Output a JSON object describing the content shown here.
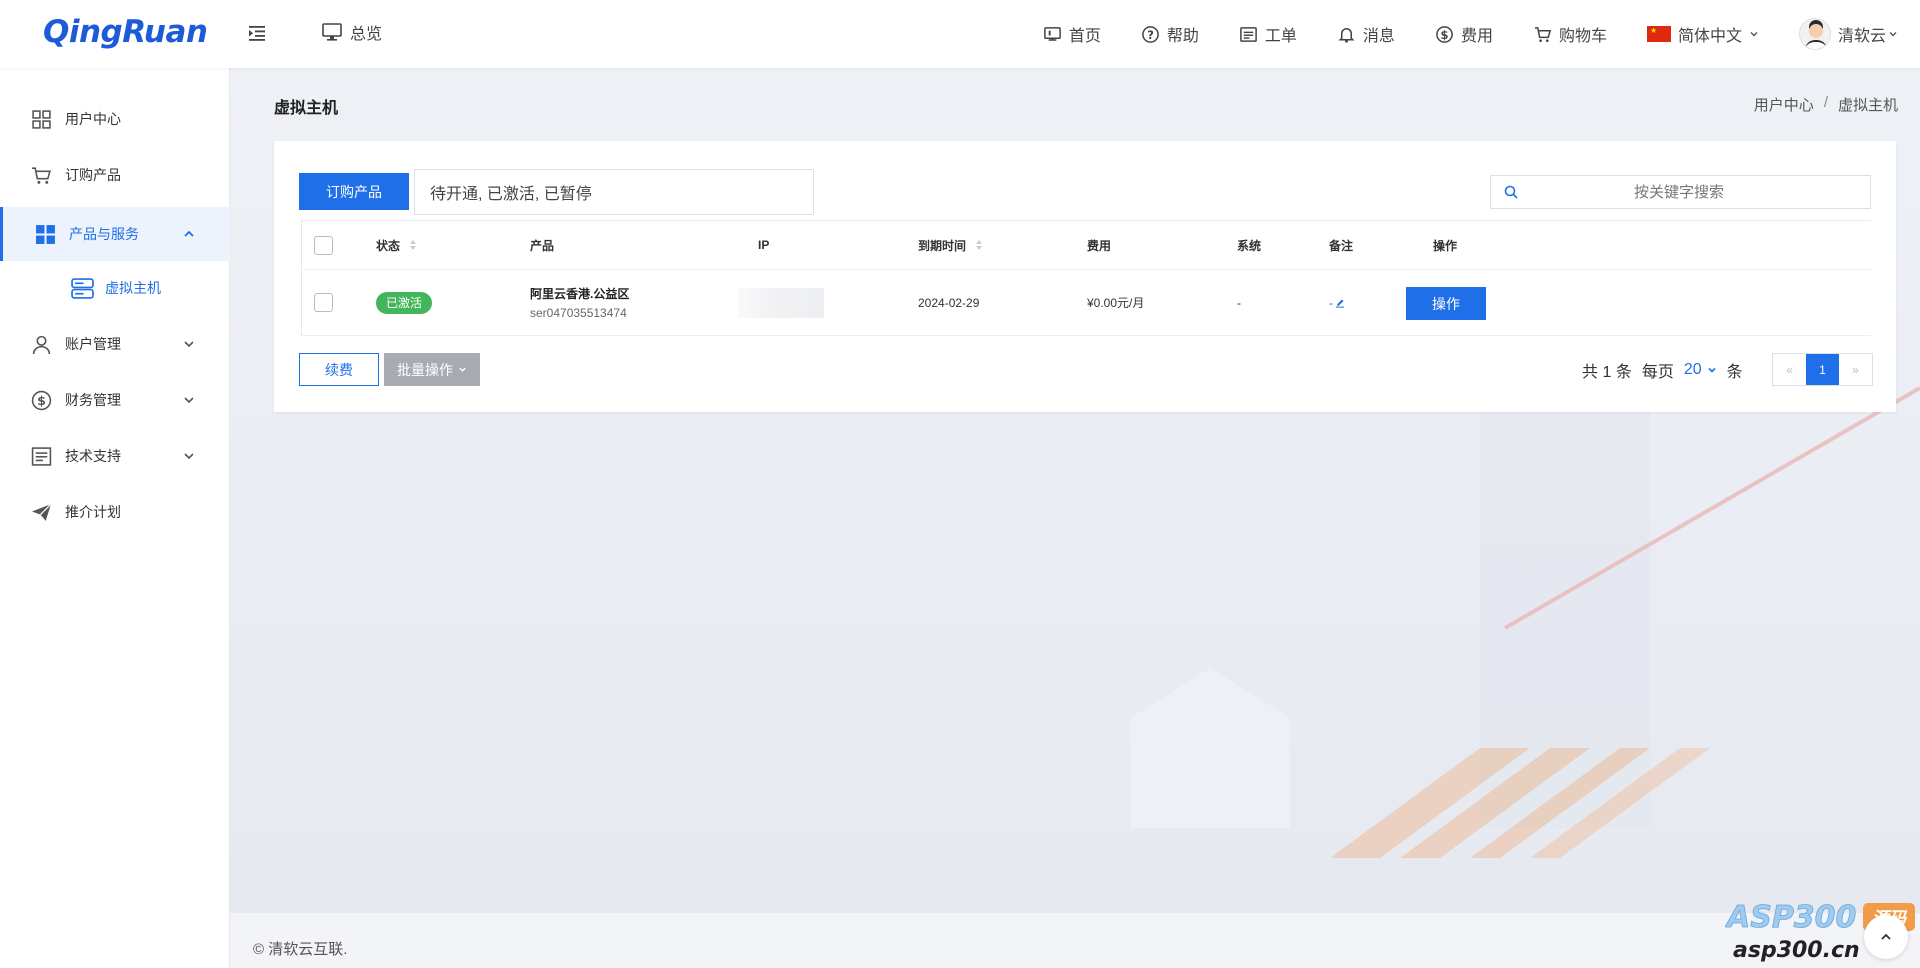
{
  "brand": {
    "logo": "QingRuan"
  },
  "header": {
    "overview_label": "总览",
    "nav": [
      {
        "label": "首页",
        "icon": "monitor-home-icon"
      },
      {
        "label": "帮助",
        "icon": "help-circle-icon"
      },
      {
        "label": "工单",
        "icon": "ticket-icon"
      },
      {
        "label": "消息",
        "icon": "bell-icon"
      },
      {
        "label": "费用",
        "icon": "dollar-circle-icon"
      },
      {
        "label": "购物车",
        "icon": "cart-icon"
      }
    ],
    "language": "简体中文",
    "user": "清软云"
  },
  "sidebar": {
    "items": [
      {
        "label": "用户中心",
        "icon": "grid-icon"
      },
      {
        "label": "订购产品",
        "icon": "cart-icon"
      },
      {
        "label": "产品与服务",
        "icon": "apps-icon",
        "active": true,
        "expanded": true
      },
      {
        "label": "虚拟主机",
        "icon": "server-icon",
        "sub": true
      },
      {
        "label": "账户管理",
        "icon": "user-icon"
      },
      {
        "label": "财务管理",
        "icon": "dollar-circle-icon"
      },
      {
        "label": "技术支持",
        "icon": "document-icon"
      },
      {
        "label": "推介计划",
        "icon": "send-icon"
      }
    ]
  },
  "page": {
    "title": "虚拟主机",
    "breadcrumb": [
      "用户中心",
      "虚拟主机"
    ]
  },
  "toolbar": {
    "order_button": "订购产品",
    "status_filter": "待开通, 已激活, 已暂停",
    "search_placeholder": "按关键字搜索"
  },
  "table": {
    "columns": [
      "状态",
      "产品",
      "IP",
      "到期时间",
      "费用",
      "系统",
      "备注",
      "操作"
    ],
    "rows": [
      {
        "status": "已激活",
        "product_name": "阿里云香港.公益区",
        "product_id": "ser047035513474",
        "ip": "",
        "expire": "2024-02-29",
        "fee": "¥0.00元/月",
        "os": "-",
        "note": "-",
        "action": "操作"
      }
    ]
  },
  "footer_actions": {
    "renew": "续费",
    "batch": "批量操作"
  },
  "pagination": {
    "total_prefix": "共",
    "total": "1",
    "total_suffix": "条",
    "per_page_label": "每页",
    "per_page": "20",
    "per_page_suffix": "条",
    "prev": "«",
    "current": "1",
    "next": "»"
  },
  "footer": {
    "copyright": "© 清软云互联."
  },
  "watermark": {
    "line1": "ASP300",
    "tag": "源码",
    "line2": "asp300.cn"
  },
  "colors": {
    "primary": "#1e6fe8",
    "success": "#43b55b",
    "disabled": "#a8abb2"
  }
}
